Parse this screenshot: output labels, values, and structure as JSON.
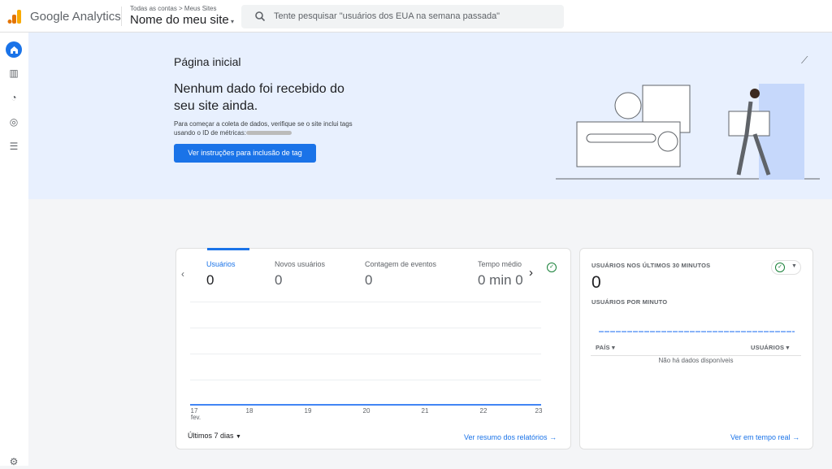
{
  "header": {
    "brand": "Google Analytics",
    "breadcrumb": "Todas as contas > Meus Sites",
    "property": "Nome do meu site",
    "search_placeholder": "Tente pesquisar \"usuários dos EUA na semana passada\""
  },
  "sidebar": {
    "items": [
      "home-icon",
      "reports-icon",
      "explore-icon",
      "advertising-icon",
      "configure-icon",
      "settings-icon"
    ]
  },
  "hero": {
    "title": "Página inicial",
    "heading": "Nenhum dado foi recebido do seu site ainda.",
    "description": "Para começar a coleta de dados, verifique se o site inclui tags usando o ID de métricas:",
    "button": "Ver instruções para inclusão de tag"
  },
  "overview": {
    "metrics": [
      {
        "label": "Usuários",
        "value": "0"
      },
      {
        "label": "Novos usuários",
        "value": "0"
      },
      {
        "label": "Contagem de eventos",
        "value": "0"
      },
      {
        "label": "Tempo médio",
        "value": "0 min 0"
      }
    ],
    "x_labels": [
      "17",
      "18",
      "19",
      "20",
      "21",
      "22",
      "23"
    ],
    "x_month": "fev.",
    "date_range": "Últimos 7 dias",
    "link": "Ver resumo dos relatórios"
  },
  "realtime": {
    "title": "USUÁRIOS NOS ÚLTIMOS 30 MINUTOS",
    "value": "0",
    "per_minute": "USUÁRIOS POR MINUTO",
    "col_country": "PAÍS",
    "col_users": "USUÁRIOS",
    "empty": "Não há dados disponíveis",
    "link": "Ver em tempo real"
  },
  "colors": {
    "accent": "#1a73e8",
    "hero_bg": "#e8f0fe",
    "logo": "#f9ab00"
  }
}
